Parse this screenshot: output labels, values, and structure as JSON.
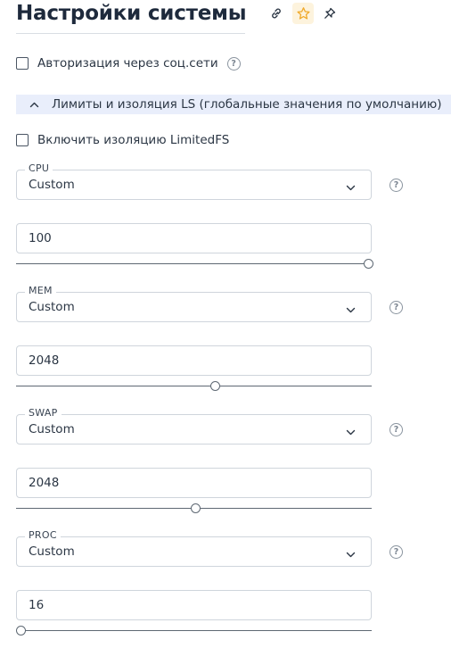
{
  "header": {
    "title": "Настройки системы",
    "icons": [
      "link-icon",
      "star-icon",
      "pin-icon"
    ]
  },
  "social_auth": {
    "label": "Авторизация через соц.сети",
    "checked": false,
    "help": "?"
  },
  "section": {
    "label": "Лимиты и изоляция LS (глобальные значения по умолчанию)",
    "expanded": true
  },
  "limitedfs": {
    "label": "Включить изоляцию LimitedFS",
    "checked": false
  },
  "fields": {
    "cpu": {
      "label": "CPU",
      "mode": "Custom",
      "value": "100",
      "slider_fraction": 0.99,
      "help": "?"
    },
    "mem": {
      "label": "MEM",
      "mode": "Custom",
      "value": "2048",
      "slider_fraction": 0.56,
      "help": "?"
    },
    "swap": {
      "label": "SWAP",
      "mode": "Custom",
      "value": "2048",
      "slider_fraction": 0.505,
      "help": "?"
    },
    "proc": {
      "label": "PROC",
      "mode": "Custom",
      "value": "16",
      "slider_fraction": 0.015,
      "help": "?"
    }
  },
  "colors": {
    "accent_bar": "#e9eefb",
    "star_bg": "#fdf3dd",
    "star": "#f0a92a",
    "text": "#1e2a3c"
  }
}
